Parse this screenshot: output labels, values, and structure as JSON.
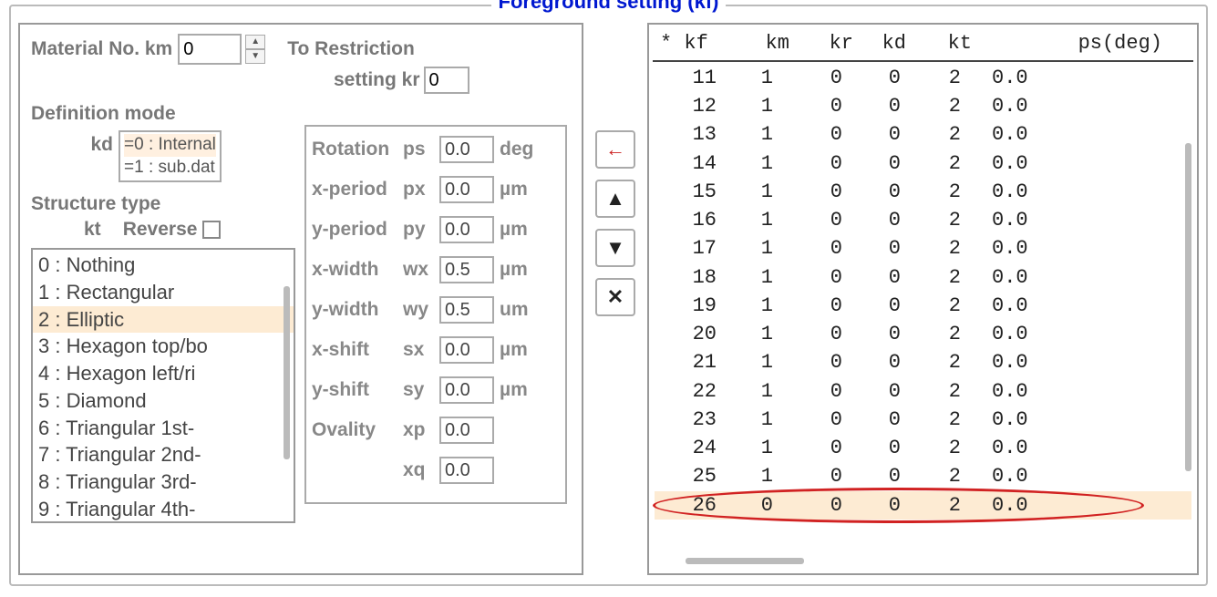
{
  "legend": "Foreground setting (kf)",
  "left": {
    "material_label": "Material No.  km",
    "km_value": "0",
    "to_restriction": "To Restriction",
    "setting_kr": "setting  kr",
    "kr_value": "0",
    "definition_mode": "Definition mode",
    "kd_label": "kd",
    "kd_options": [
      "=0 : Internal",
      "=1 : sub.dat"
    ],
    "structure_type": "Structure type",
    "kt_label": "kt",
    "reverse_label": "Reverse",
    "kt_items": [
      "0 : Nothing",
      "1 : Rectangular",
      "2 : Elliptic",
      "3 : Hexagon top/bo",
      "4 : Hexagon left/ri",
      "5 : Diamond",
      "6 : Triangular 1st-",
      "7 : Triangular 2nd-",
      "8 : Triangular 3rd-",
      "9 : Triangular 4th-"
    ],
    "kt_selected_index": 2
  },
  "params": [
    {
      "name": "Rotation",
      "sym": "ps",
      "value": "0.0",
      "unit": "deg"
    },
    {
      "name": "x-period",
      "sym": "px",
      "value": "0.0",
      "unit": "µm"
    },
    {
      "name": "y-period",
      "sym": "py",
      "value": "0.0",
      "unit": "µm"
    },
    {
      "name": "x-width",
      "sym": "wx",
      "value": "0.5",
      "unit": "µm"
    },
    {
      "name": "y-width",
      "sym": "wy",
      "value": "0.5",
      "unit": "um"
    },
    {
      "name": "x-shift",
      "sym": "sx",
      "value": "0.0",
      "unit": "µm"
    },
    {
      "name": "y-shift",
      "sym": "sy",
      "value": "0.0",
      "unit": "µm"
    },
    {
      "name": "Ovality",
      "sym": "xp",
      "value": "0.0",
      "unit": ""
    },
    {
      "name": "",
      "sym": "xq",
      "value": "0.0",
      "unit": ""
    }
  ],
  "table": {
    "headers": {
      "kf": "* kf",
      "km": "km",
      "kr": "kr",
      "kd": "kd",
      "kt": "kt",
      "ps": "ps(deg)"
    },
    "rows": [
      {
        "kf": "11",
        "km": "1",
        "kr": "0",
        "kd": "0",
        "kt": "2",
        "ps": "0.0"
      },
      {
        "kf": "12",
        "km": "1",
        "kr": "0",
        "kd": "0",
        "kt": "2",
        "ps": "0.0"
      },
      {
        "kf": "13",
        "km": "1",
        "kr": "0",
        "kd": "0",
        "kt": "2",
        "ps": "0.0"
      },
      {
        "kf": "14",
        "km": "1",
        "kr": "0",
        "kd": "0",
        "kt": "2",
        "ps": "0.0"
      },
      {
        "kf": "15",
        "km": "1",
        "kr": "0",
        "kd": "0",
        "kt": "2",
        "ps": "0.0"
      },
      {
        "kf": "16",
        "km": "1",
        "kr": "0",
        "kd": "0",
        "kt": "2",
        "ps": "0.0"
      },
      {
        "kf": "17",
        "km": "1",
        "kr": "0",
        "kd": "0",
        "kt": "2",
        "ps": "0.0"
      },
      {
        "kf": "18",
        "km": "1",
        "kr": "0",
        "kd": "0",
        "kt": "2",
        "ps": "0.0"
      },
      {
        "kf": "19",
        "km": "1",
        "kr": "0",
        "kd": "0",
        "kt": "2",
        "ps": "0.0"
      },
      {
        "kf": "20",
        "km": "1",
        "kr": "0",
        "kd": "0",
        "kt": "2",
        "ps": "0.0"
      },
      {
        "kf": "21",
        "km": "1",
        "kr": "0",
        "kd": "0",
        "kt": "2",
        "ps": "0.0"
      },
      {
        "kf": "22",
        "km": "1",
        "kr": "0",
        "kd": "0",
        "kt": "2",
        "ps": "0.0"
      },
      {
        "kf": "23",
        "km": "1",
        "kr": "0",
        "kd": "0",
        "kt": "2",
        "ps": "0.0"
      },
      {
        "kf": "24",
        "km": "1",
        "kr": "0",
        "kd": "0",
        "kt": "2",
        "ps": "0.0"
      },
      {
        "kf": "25",
        "km": "1",
        "kr": "0",
        "kd": "0",
        "kt": "2",
        "ps": "0.0"
      },
      {
        "kf": "26",
        "km": "0",
        "kr": "0",
        "kd": "0",
        "kt": "2",
        "ps": "0.0",
        "highlight": true
      }
    ]
  },
  "buttons": {
    "left_arrow": "←",
    "up": "▲",
    "down": "▼",
    "delete": "✕"
  }
}
